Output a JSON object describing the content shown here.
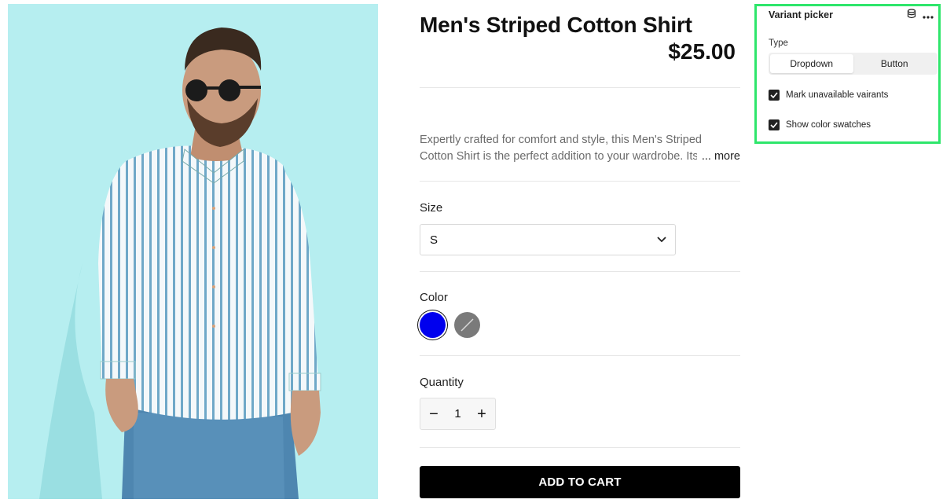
{
  "product": {
    "title": "Men's Striped Cotton Shirt",
    "price": "$25.00",
    "description_line1": "Expertly crafted for comfort and style, this Men's Striped",
    "description_line2": "Cotton Shirt is the perfect addition to your wardrobe. Its",
    "more_label": "... more",
    "size_label": "Size",
    "size_selected": "S",
    "color_label": "Color",
    "colors": [
      {
        "name": "blue",
        "hex": "#0000ee",
        "selected": true,
        "available": true
      },
      {
        "name": "grey",
        "hex": "#7a7a7a",
        "selected": false,
        "available": false
      }
    ],
    "quantity_label": "Quantity",
    "quantity_value": "1",
    "quantity_decrement": "−",
    "quantity_increment": "+",
    "add_to_cart_label": "ADD TO CART"
  },
  "panel": {
    "title": "Variant picker",
    "icons": [
      "database-icon",
      "more-horizontal-icon"
    ],
    "type_label": "Type",
    "type_options": [
      "Dropdown",
      "Button"
    ],
    "type_selected": "Dropdown",
    "checkbox_unavailable_label": "Mark unavailable vairants",
    "checkbox_unavailable_checked": true,
    "checkbox_swatches_label": "Show color swatches",
    "checkbox_swatches_checked": true
  },
  "colors": {
    "image_background": "#b6eef0",
    "panel_border": "#2ee66b",
    "button_background": "#000000"
  }
}
